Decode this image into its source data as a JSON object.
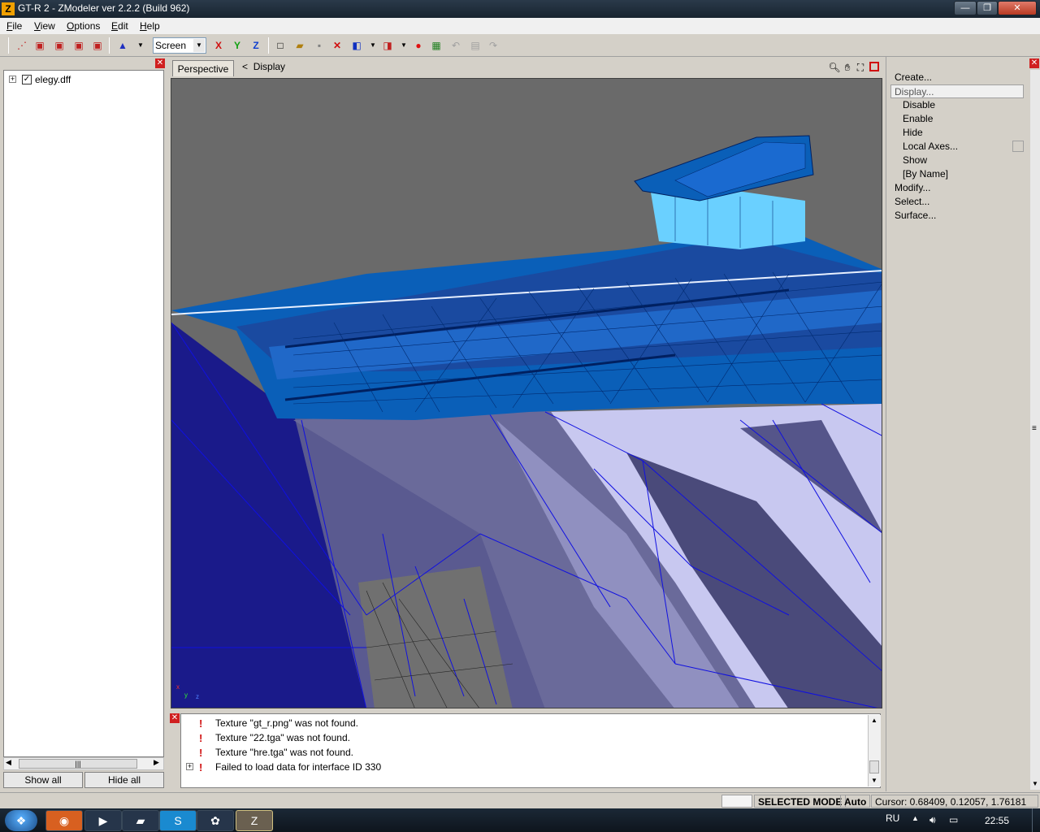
{
  "window": {
    "title": "GT-R 2 - ZModeler ver 2.2.2 (Build 962)",
    "minimize": "—",
    "restore": "❐",
    "close": "✕"
  },
  "menu": [
    "File",
    "View",
    "Options",
    "Edit",
    "Help"
  ],
  "toolbar": {
    "space_select": "Screen",
    "axis_x": "X",
    "axis_y": "Y",
    "axis_z": "Z"
  },
  "scene_tree": {
    "items": [
      {
        "label": "elegy.dff",
        "checked": "✓",
        "expander": "+"
      }
    ]
  },
  "left_buttons": {
    "show_all": "Show all",
    "hide_all": "Hide all"
  },
  "viewport": {
    "tab": "Perspective",
    "breadcrumb_sep": "<",
    "breadcrumb": "Display"
  },
  "log": {
    "entries": [
      {
        "text": "Texture \"gt_r.png\" was not found."
      },
      {
        "text": "Texture \"22.tga\" was not found."
      },
      {
        "text": "Texture \"hre.tga\" was not found."
      },
      {
        "text": "Failed to load data for interface ID 330"
      }
    ]
  },
  "commands": {
    "create": "Create...",
    "display": "Display...",
    "display_sub": [
      "Disable",
      "Enable",
      "Hide",
      "Local Axes...",
      "Show",
      "[By Name]"
    ],
    "modify": "Modify...",
    "select": "Select...",
    "surface": "Surface..."
  },
  "status": {
    "mode": "SELECTED MODE",
    "auto": "Auto",
    "cursor": "Cursor: 0.68409, 0.12057, 1.76181"
  },
  "taskbar": {
    "lang": "RU",
    "clock": "22:55"
  },
  "colors": {
    "mesh_blue": "#0a5fb8",
    "wire": "#1010e0",
    "surface_lavender": "#c8c8f0"
  }
}
